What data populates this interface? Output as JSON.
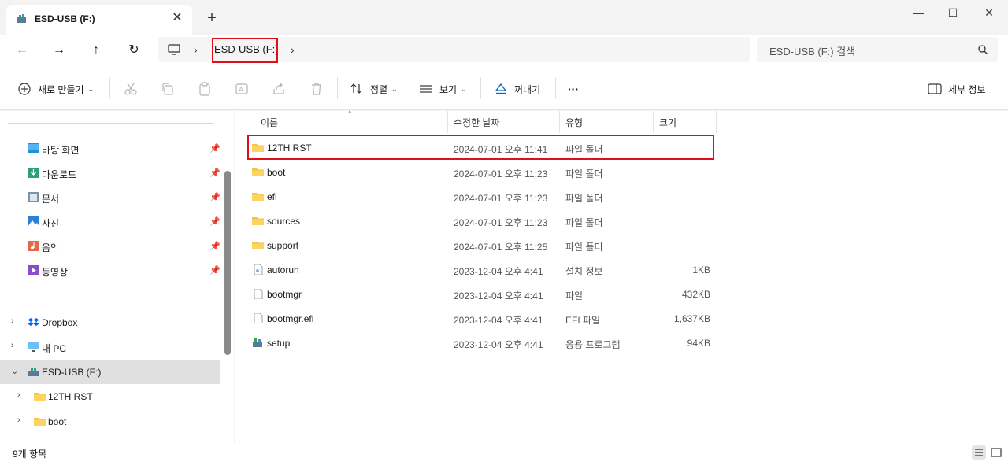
{
  "tab": {
    "title": "ESD-USB (F:)",
    "close": "✕",
    "new": "+"
  },
  "window": {
    "minimize": "—",
    "maximize": "☐",
    "close": "✕"
  },
  "nav": {
    "back": "←",
    "forward": "→",
    "up": "↑",
    "refresh": "↻"
  },
  "address": {
    "crumb": "ESD-USB (F:)",
    "sep1": "›",
    "sep2": "›"
  },
  "search": {
    "placeholder": "ESD-USB (F:) 검색"
  },
  "toolbar": {
    "new_label": "새로 만들기",
    "sort_label": "정렬",
    "view_label": "보기",
    "eject_label": "꺼내기",
    "more_label": "···",
    "details_label": "세부 정보"
  },
  "sidebar": {
    "quick": [
      {
        "label": "바탕 화면",
        "icon": "desktop-icon"
      },
      {
        "label": "다운로드",
        "icon": "download-icon"
      },
      {
        "label": "문서",
        "icon": "documents-icon"
      },
      {
        "label": "사진",
        "icon": "pictures-icon"
      },
      {
        "label": "음악",
        "icon": "music-icon"
      },
      {
        "label": "동영상",
        "icon": "videos-icon"
      }
    ],
    "pin": "📌",
    "tree": [
      {
        "label": "Dropbox",
        "icon": "dropbox-icon",
        "expander": "›"
      },
      {
        "label": "내 PC",
        "icon": "pc-icon",
        "expander": "›"
      },
      {
        "label": "ESD-USB (F:)",
        "icon": "usb-drive-icon",
        "expander": "⌄"
      },
      {
        "label": "12TH RST",
        "icon": "folder-icon",
        "expander": "›"
      },
      {
        "label": "boot",
        "icon": "folder-icon",
        "expander": "›"
      }
    ]
  },
  "columns": {
    "name": "이름",
    "modified": "수정한 날짜",
    "type": "유형",
    "size": "크기",
    "sort_caret": "^"
  },
  "files": [
    {
      "name": "12TH RST",
      "date": "2024-07-01 오후 11:41",
      "type": "파일 폴더",
      "size": "",
      "icon": "folder-icon"
    },
    {
      "name": "boot",
      "date": "2024-07-01 오후 11:23",
      "type": "파일 폴더",
      "size": "",
      "icon": "folder-icon"
    },
    {
      "name": "efi",
      "date": "2024-07-01 오후 11:23",
      "type": "파일 폴더",
      "size": "",
      "icon": "folder-icon"
    },
    {
      "name": "sources",
      "date": "2024-07-01 오후 11:23",
      "type": "파일 폴더",
      "size": "",
      "icon": "folder-icon"
    },
    {
      "name": "support",
      "date": "2024-07-01 오후 11:25",
      "type": "파일 폴더",
      "size": "",
      "icon": "folder-icon"
    },
    {
      "name": "autorun",
      "date": "2023-12-04 오후 4:41",
      "type": "설치 정보",
      "size": "1KB",
      "icon": "setup-info-icon"
    },
    {
      "name": "bootmgr",
      "date": "2023-12-04 오후 4:41",
      "type": "파일",
      "size": "432KB",
      "icon": "file-icon"
    },
    {
      "name": "bootmgr.efi",
      "date": "2023-12-04 오후 4:41",
      "type": "EFI 파일",
      "size": "1,637KB",
      "icon": "file-icon"
    },
    {
      "name": "setup",
      "date": "2023-12-04 오후 4:41",
      "type": "응용 프로그램",
      "size": "94KB",
      "icon": "setup-app-icon"
    }
  ],
  "status": {
    "count": "9개 항목"
  },
  "colors": {
    "highlight": "#e0101a",
    "folder": "#f5c242",
    "accent": "#0067c0"
  }
}
